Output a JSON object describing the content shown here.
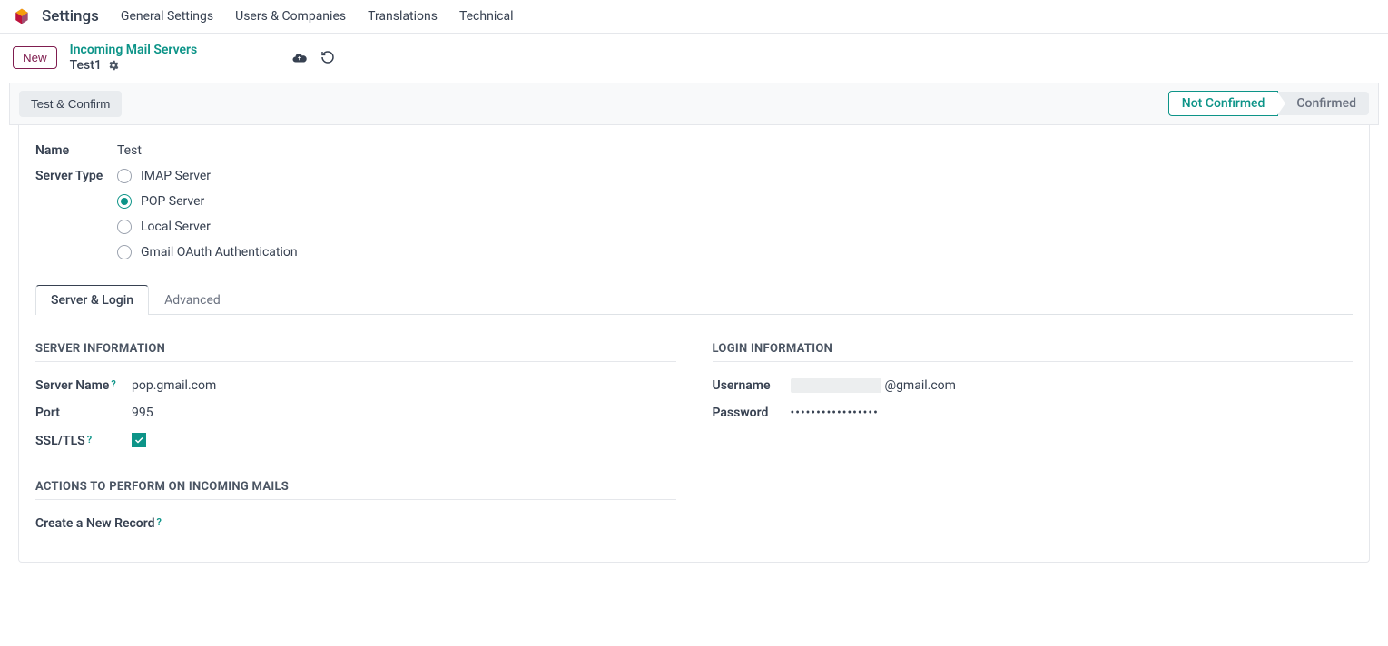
{
  "topbar": {
    "app_title": "Settings",
    "menu": {
      "general": "General Settings",
      "users": "Users & Companies",
      "translations": "Translations",
      "technical": "Technical"
    }
  },
  "subheader": {
    "new_button": "New",
    "breadcrumb_parent": "Incoming Mail Servers",
    "breadcrumb_current": "Test1"
  },
  "statusbar": {
    "test_confirm": "Test & Confirm",
    "status_not_confirmed": "Not Confirmed",
    "status_confirmed": "Confirmed"
  },
  "form": {
    "name_label": "Name",
    "name_value": "Test",
    "server_type_label": "Server Type",
    "server_types": {
      "imap": "IMAP Server",
      "pop": "POP Server",
      "local": "Local Server",
      "gmail": "Gmail OAuth Authentication"
    }
  },
  "tabs": {
    "server_login": "Server & Login",
    "advanced": "Advanced"
  },
  "server_info": {
    "section_title": "Server Information",
    "server_name_label": "Server Name",
    "server_name_value": "pop.gmail.com",
    "port_label": "Port",
    "port_value": "995",
    "ssl_label": "SSL/TLS"
  },
  "login_info": {
    "section_title": "Login Information",
    "username_label": "Username",
    "username_suffix": "@gmail.com",
    "password_label": "Password",
    "password_value": "•••••••••••••••••"
  },
  "actions": {
    "section_title": "Actions to Perform on Incoming Mails",
    "create_record_label": "Create a New Record"
  },
  "help": "?"
}
